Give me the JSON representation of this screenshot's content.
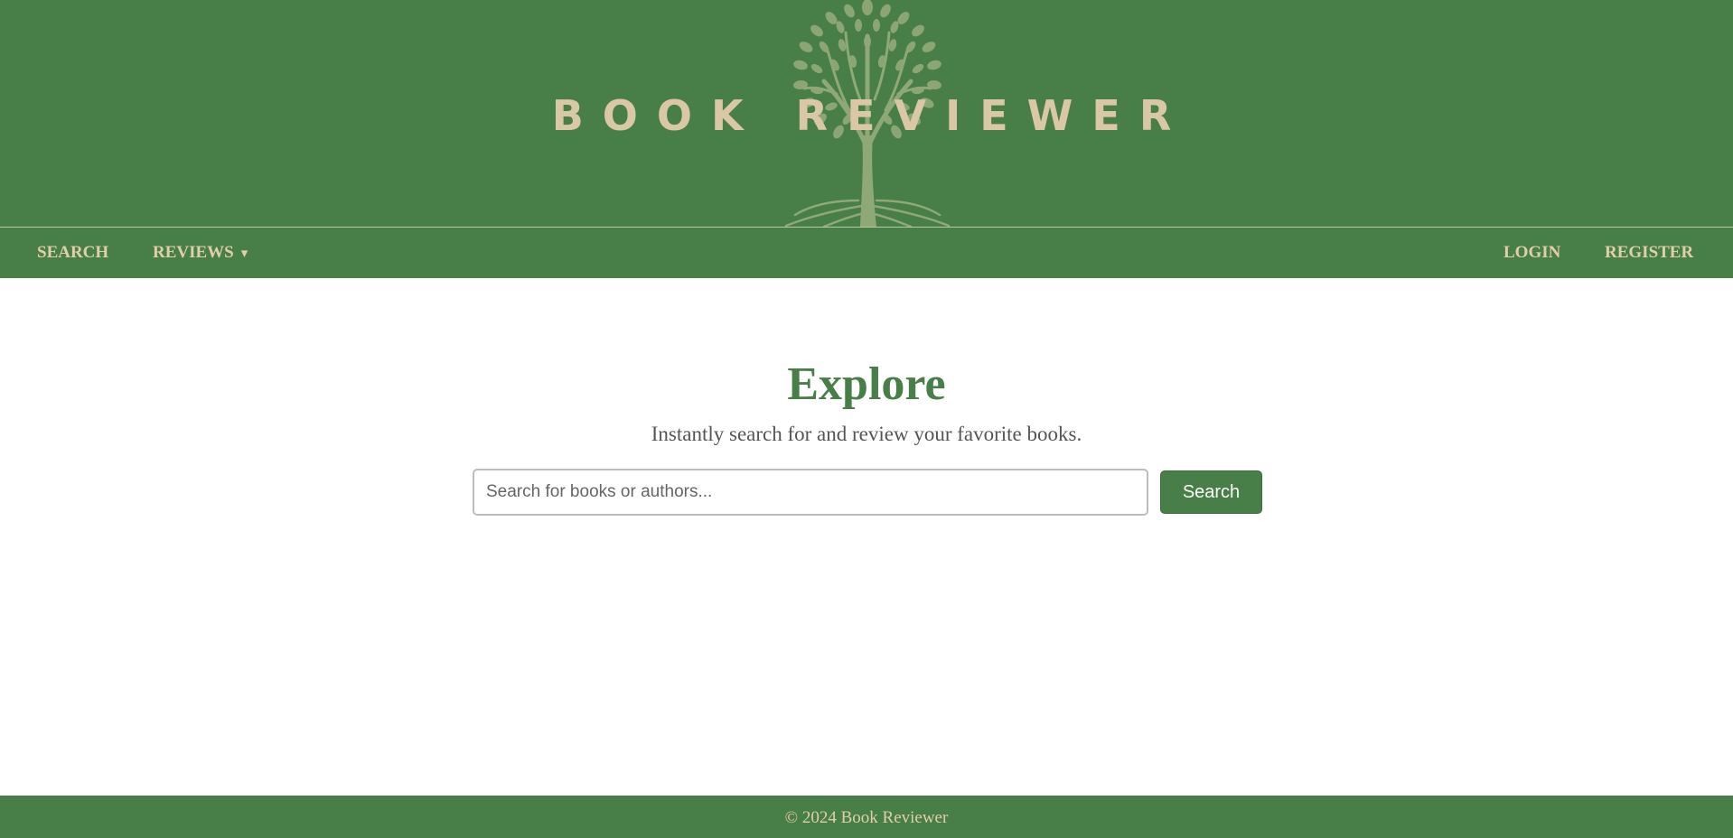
{
  "header": {
    "brand_title": "BOOK REVIEWER"
  },
  "nav": {
    "left": [
      {
        "label": "SEARCH"
      },
      {
        "label": "REVIEWS",
        "caret": "▾"
      }
    ],
    "right": [
      {
        "label": "LOGIN"
      },
      {
        "label": "REGISTER"
      }
    ]
  },
  "main": {
    "title": "Explore",
    "subtitle": "Instantly search for and review your favorite books.",
    "search": {
      "placeholder": "Search for books or authors...",
      "value": "",
      "button_label": "Search"
    }
  },
  "footer": {
    "text": "© 2024 Book Reviewer"
  },
  "colors": {
    "brand_green": "#487e47",
    "accent_tan": "#d9c7a6",
    "tree_green": "#8fa877",
    "subtitle_gray": "#555555"
  },
  "icons": {
    "logo": "tree-logo-icon",
    "dropdown": "caret-down-icon"
  }
}
